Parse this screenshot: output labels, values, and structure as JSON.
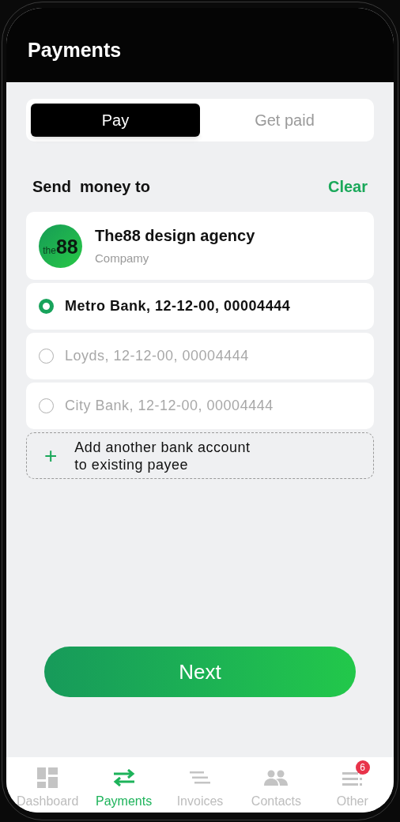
{
  "header": {
    "title": "Payments"
  },
  "tabs": [
    {
      "label": "Pay",
      "selected": true
    },
    {
      "label": "Get paid",
      "selected": false
    }
  ],
  "section": {
    "title": "Send  money to",
    "action": "Clear"
  },
  "payee": {
    "logo_small": "the",
    "logo_big": "88",
    "name": "The88 design agency",
    "type": "Compamy"
  },
  "accounts": [
    {
      "label": "Metro Bank, 12-12-00, 00004444",
      "selected": true
    },
    {
      "label": "Loyds, 12-12-00, 00004444",
      "selected": false
    },
    {
      "label": "City Bank, 12-12-00, 00004444",
      "selected": false
    }
  ],
  "add_account": {
    "icon": "+",
    "label": "Add another bank account to existing payee"
  },
  "next_button": "Next",
  "nav": [
    {
      "kind": "dashboard",
      "label": "Dashboard",
      "selected": false
    },
    {
      "kind": "payments",
      "label": "Payments",
      "selected": true
    },
    {
      "kind": "invoices",
      "label": "Invoices",
      "selected": false
    },
    {
      "kind": "contacts",
      "label": "Contacts",
      "selected": false
    },
    {
      "kind": "other",
      "label": "Other",
      "selected": false,
      "badge": "6"
    }
  ]
}
